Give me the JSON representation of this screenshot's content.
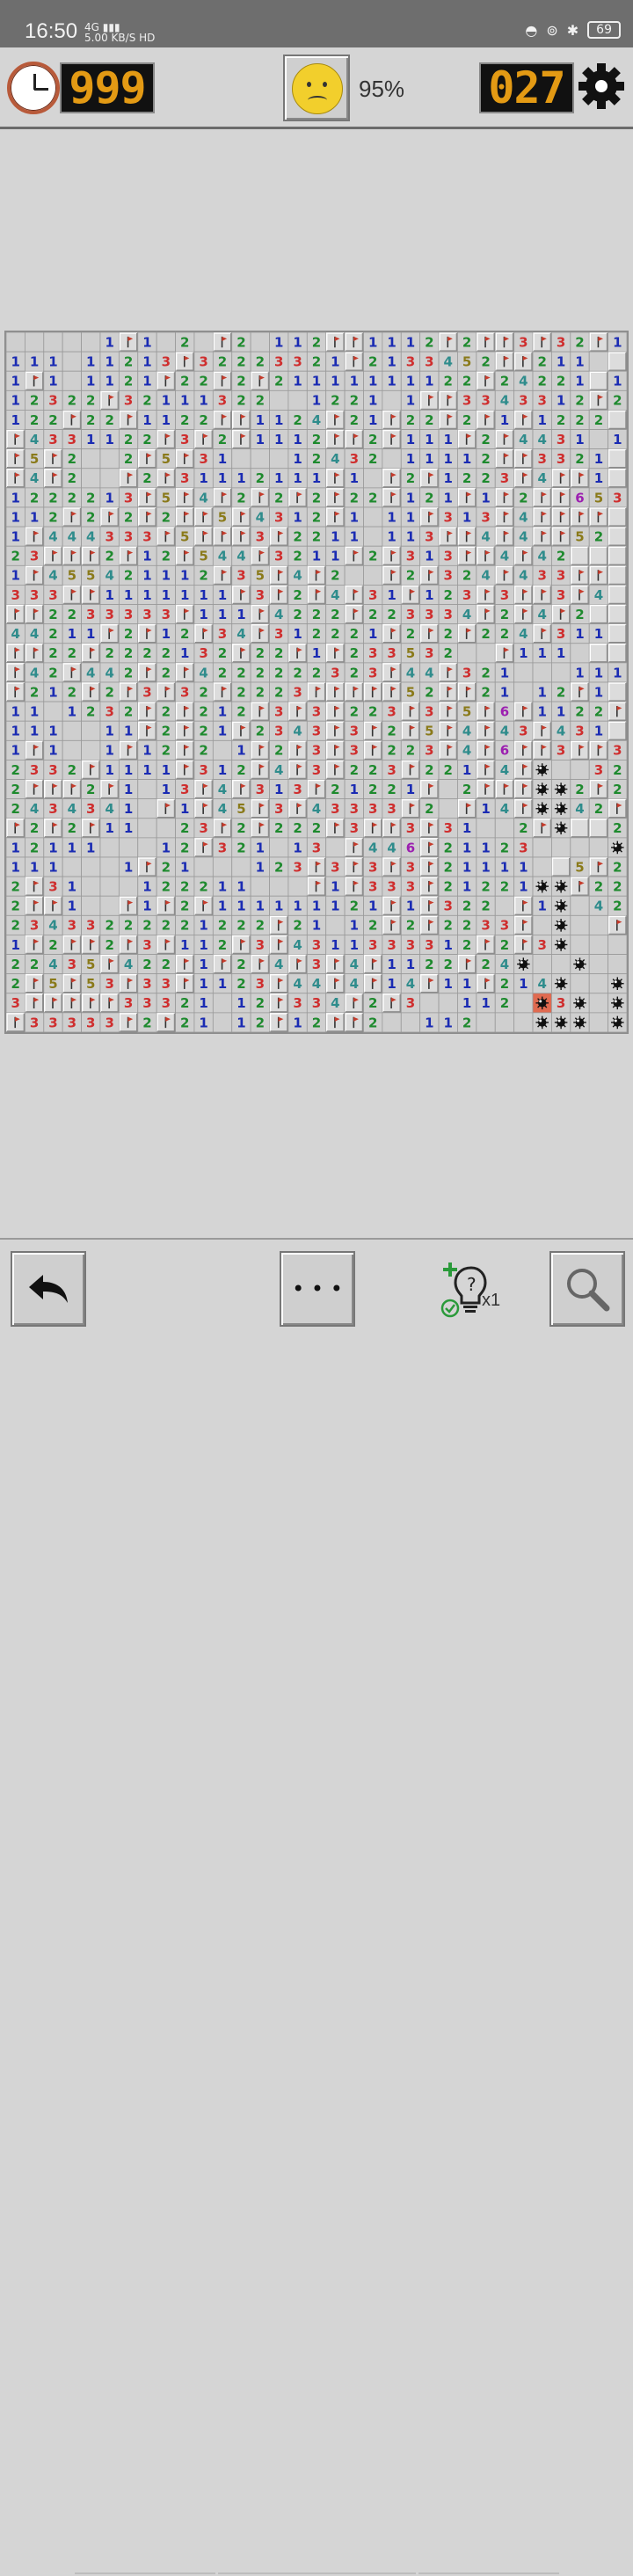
{
  "status_bar": {
    "time": "16:50",
    "network": "4G",
    "speed": "5.00",
    "speed_unit": "KB/S",
    "hd": "HD",
    "battery": "69"
  },
  "top_bar": {
    "timer_icon": "clock-icon",
    "timer_value": "999",
    "face_icon": "sad-face-icon",
    "percent": "95%",
    "mines_remaining": "027",
    "settings_icon": "gear-icon"
  },
  "board": {
    "cols": 33,
    "rows": 36,
    "legend": "0-8 = revealed number (0 blank), F = flag, M = mine, X = exploded mine, U = unrevealed",
    "grid": [
      "000001F1020F20112FF1112F2FF3F32F1U",
      "111011213F32223321F2133452FF2110U",
      "1F101121F22F2F21111111122F24221U1",
      "12322F3211132200122101FF3343312F2",
      "122F22F1122FF1124F21F22F2F1F1222",
      "F4331122F3F2F1112FF2F111F2F443101",
      "F5F2002F5F3100012432011112FF3321",
      "F4F200F2F31112111F10F2F1223F4FF1",
      "1222213F5F4F2F2F2F22F121F1F2FF653",
      "112F2F2F2FF5F4312F1011F313F4FFFF",
      "1F444333F5FFF3F22110113FF4F4FF52",
      "23FFF2F12F544F3211F2F313FF4F42",
      "1F455421112F35F4F200F2F324F433FF",
      "333FF1111111F3F2F4F31F123F3FF3F4",
      "FF2233333F111F4222F223334F2F4F2",
      "44211F2F12F34F312221F2F2F224F311",
      "FF22F2222132F22F1F23353200F1110",
      "F42F442F2F4222222323F44F321000111",
      "F212F2F3F32F2223FFFFF52FF21012F1",
      "1101232F2F212F3F3F223F3F5F6F1122F1",
      "1110011F2F21F2343F3F2F5F4F43F431",
      "1F1001F12F201F2F3F3F223F4F6FF3FF3",
      "2332F1111F312F4F3F223F221F4FM0032F",
      "2FFF2F1013F4F313F21221F02FFFMM2F2F22",
      "24343410F1F45F3F43333F20F14FMM42F211",
      "F2F2F110023F2F222F3FF3F31002FMUU22F1",
      "1211100012F3210130F446F211230000M2211",
      "1110001F21000123F3F3F3F211110U5F2",
      "2F31000122211000F1F333F21221MMF2211",
      "2FF100F1F2F111111121F1F3220F1M0422F2",
      "23433222221222F21012F2F2233F0M00F0M0",
      "1F2FF2F3F112F3F4311333312F2F3M0000M0",
      "22435F422F1F2F4F3F4F1122F24M00M00M",
      "2F5F53F33F1123F44F4F14F11F214M00M00",
      "3FFFFF33321012F334F2F3001120X3M0MMMM",
      "F33333F2F21012F12FF200112000MMM0MMM"
    ]
  },
  "bottom_bar": {
    "undo_icon": "undo-arrow-icon",
    "more_label": "• • •",
    "hint_icon": "lightbulb-hint-icon",
    "hint_count": "x1",
    "zoom_icon": "magnifier-icon"
  },
  "colors": {
    "n1": "#1a2bb3",
    "n2": "#1e8a2e",
    "n3": "#cf2e2e",
    "n4": "#2f8c8c",
    "n5": "#8a7a1a",
    "n6": "#9c1fb0",
    "flag": "#c63b2b",
    "exploded": "#e06a50",
    "digit": "#e39a14",
    "tile": "#dcdcdc",
    "revealed": "#cfcfcf"
  }
}
